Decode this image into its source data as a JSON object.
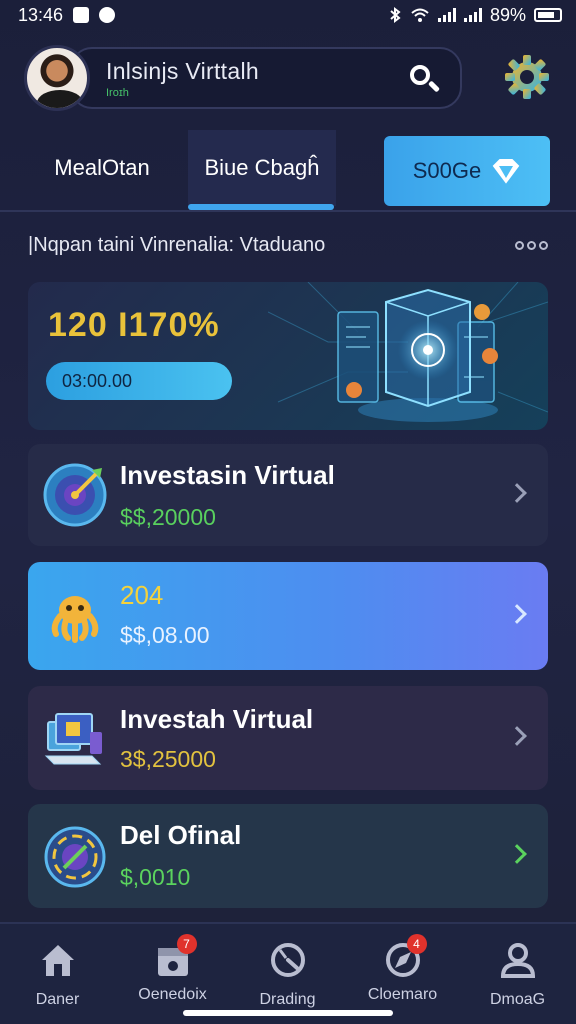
{
  "status_bar": {
    "time": "13:46",
    "battery": "89%"
  },
  "header": {
    "search_title": "Inlsinjs Virttalh",
    "search_subtitle": "Iroɪh"
  },
  "tabs": [
    {
      "label": "MealOtan"
    },
    {
      "label": "Biue Cbagĥ",
      "active": true
    },
    {
      "label": "S00Ge"
    }
  ],
  "section": {
    "title": "|Nqpan taini Vinrenalia: Vtaduano"
  },
  "hero": {
    "value": "120 I170%",
    "pill": "03:00.00"
  },
  "cards": [
    {
      "title": "Investasin Virtual",
      "amount": "$$,20000"
    },
    {
      "title": "204",
      "amount": "$$,08.00"
    },
    {
      "title": "Investah Virtual",
      "amount": "3$,25000"
    },
    {
      "title": "Del Ofinal",
      "amount": "$,0010"
    }
  ],
  "bottom_nav": [
    {
      "label": "Daner",
      "icon": "home-icon"
    },
    {
      "label": "Oenedoix",
      "icon": "calendar-icon",
      "badge": "7"
    },
    {
      "label": "Drading",
      "icon": "gauge-icon"
    },
    {
      "label": "Cloemaro",
      "icon": "compass-icon",
      "badge": "4"
    },
    {
      "label": "DmoaG",
      "icon": "profile-icon"
    }
  ],
  "colors": {
    "background": "#1b1f3a",
    "accent_blue": "#3aa2ea",
    "gold": "#e9c23a",
    "green": "#59d05e",
    "badge_red": "#e0322c"
  }
}
